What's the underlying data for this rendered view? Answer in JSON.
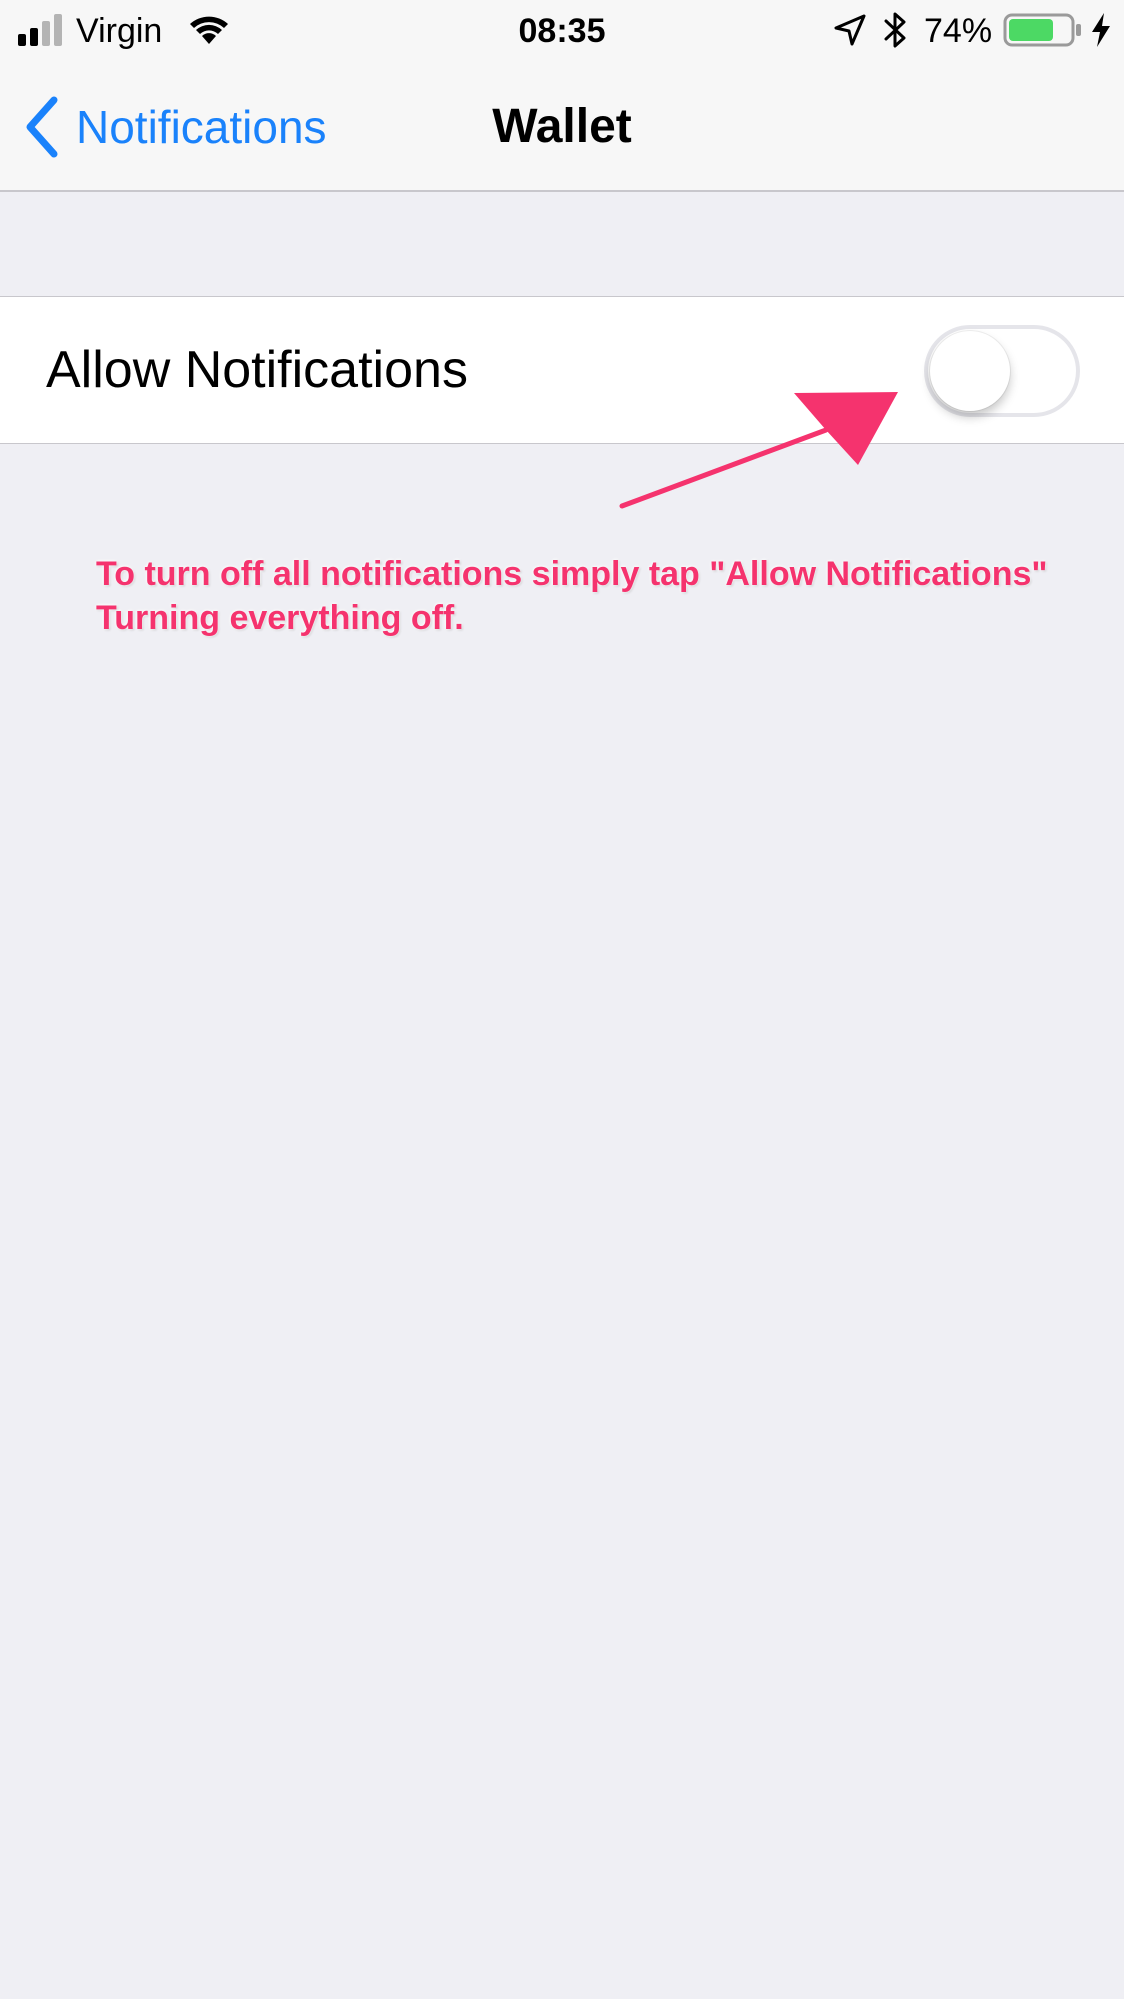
{
  "status_bar": {
    "carrier": "Virgin",
    "time": "08:35",
    "battery_percent": "74%",
    "battery_level": 0.74,
    "battery_color": "#4cd964",
    "icons": [
      "signal-icon",
      "wifi-icon",
      "location-icon",
      "bluetooth-icon",
      "battery-icon",
      "charging-icon"
    ]
  },
  "nav": {
    "back_label": "Notifications",
    "title": "Wallet",
    "accent_color": "#1a82fb"
  },
  "settings": {
    "allow_notifications": {
      "label": "Allow Notifications",
      "toggle_on": false
    }
  },
  "annotation": {
    "line1": "To turn off all notifications simply tap \"Allow Notifications\"",
    "line2": "Turning everything off.",
    "color": "#f5336e"
  }
}
